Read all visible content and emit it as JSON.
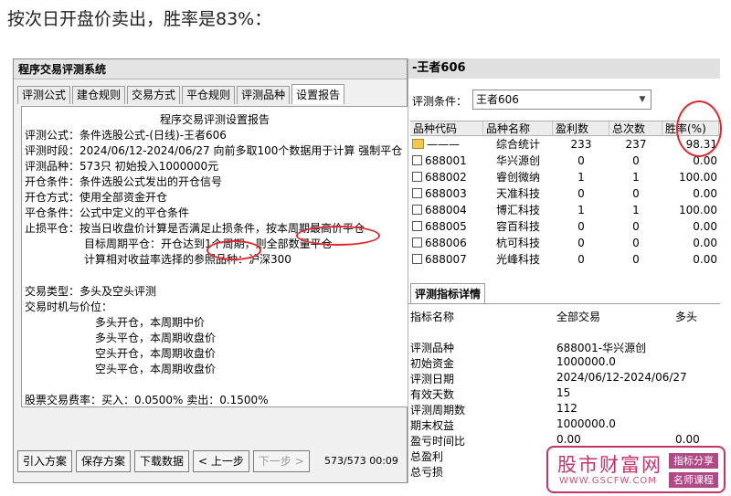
{
  "caption": "按次日开盘价卖出，胜率是83%：",
  "left": {
    "title": "程序交易评测系统",
    "tabs": [
      "评测公式",
      "建仓规则",
      "交易方式",
      "平仓规则",
      "评测品种",
      "设置报告"
    ],
    "report_title": "程序交易评测设置报告",
    "lines": [
      "评测公式：条件选股公式-(日线)-王者606",
      "评测时段：2024/06/12-2024/06/27 向前多取100个数据用于计算 强制平仓",
      "评测品种：573只 初始投入1000000元",
      "开仓条件：条件选股公式发出的开仓信号",
      "开仓方式：使用全部资金开仓",
      "平仓条件：公式中定义的平仓条件",
      "止损平仓：按当日收盘价计算是否满足止损条件，按本周期最高价平仓",
      "目标周期平仓：开仓达到1个周期，则全部数量平仓",
      "计算相对收益率选择的参照品种：沪深300",
      "交易类型：多头及空头评测",
      "交易时机与价位：",
      "多头开仓，本周期中价",
      "多头平仓，本周期收盘价",
      "空头开仓，本周期收盘价",
      "空头平仓，本周期收盘价",
      "股票交易费率：买入：0.0500% 卖出：0.1500%"
    ],
    "buttons": [
      "引入方案",
      "保存方案",
      "下载数据",
      "< 上一步",
      "下一步 >"
    ],
    "pager": "573/573 00:09"
  },
  "right": {
    "title": "-王者606",
    "cond_label": "评测条件：",
    "cond_value": "王者606",
    "headers": [
      "品种代码",
      "品种名称",
      "盈利数",
      "总次数",
      "胜率(%)"
    ],
    "rows": [
      {
        "code": "———",
        "name": "综合统计",
        "win": "233",
        "total": "237",
        "rate": "98.31"
      },
      {
        "code": "688001",
        "name": "华兴源创",
        "win": "0",
        "total": "0",
        "rate": "0.00"
      },
      {
        "code": "688002",
        "name": "睿创微纳",
        "win": "1",
        "total": "1",
        "rate": "100.00"
      },
      {
        "code": "688003",
        "name": "天准科技",
        "win": "0",
        "total": "0",
        "rate": "0.00"
      },
      {
        "code": "688004",
        "name": "博汇科技",
        "win": "1",
        "total": "1",
        "rate": "100.00"
      },
      {
        "code": "688005",
        "name": "容百科技",
        "win": "0",
        "total": "0",
        "rate": "0.00"
      },
      {
        "code": "688006",
        "name": "杭可科技",
        "win": "0",
        "total": "0",
        "rate": "0.00"
      },
      {
        "code": "688007",
        "name": "光峰科技",
        "win": "0",
        "total": "0",
        "rate": "0.00"
      }
    ],
    "detail_tab": "评测指标详情",
    "detail_headers": [
      "指标名称",
      "全部交易",
      "多头"
    ],
    "detail_rows": [
      {
        "k": "评测品种",
        "v": "688001-华兴源创",
        "v2": ""
      },
      {
        "k": "初始资金",
        "v": "1000000.0",
        "v2": ""
      },
      {
        "k": "评测日期",
        "v": "2024/06/12-2024/06/27",
        "v2": ""
      },
      {
        "k": "有效天数",
        "v": "15",
        "v2": ""
      },
      {
        "k": "评测周期数",
        "v": "112",
        "v2": ""
      },
      {
        "k": "期末权益",
        "v": "1000000.0",
        "v2": ""
      },
      {
        "k": "盈亏时间比",
        "v": "0.00",
        "v2": "0.00"
      },
      {
        "k": "总盈利",
        "v": "",
        "v2": ""
      },
      {
        "k": "总亏损",
        "v": "",
        "v2": ""
      }
    ]
  },
  "watermark": {
    "name": "股市财富网",
    "url": "WWW.GSCFW.COM",
    "tag1": "指标分享",
    "tag2": "名师课程"
  },
  "colors": {
    "annotation": "#e3262d",
    "watermark": "#c7326a"
  }
}
